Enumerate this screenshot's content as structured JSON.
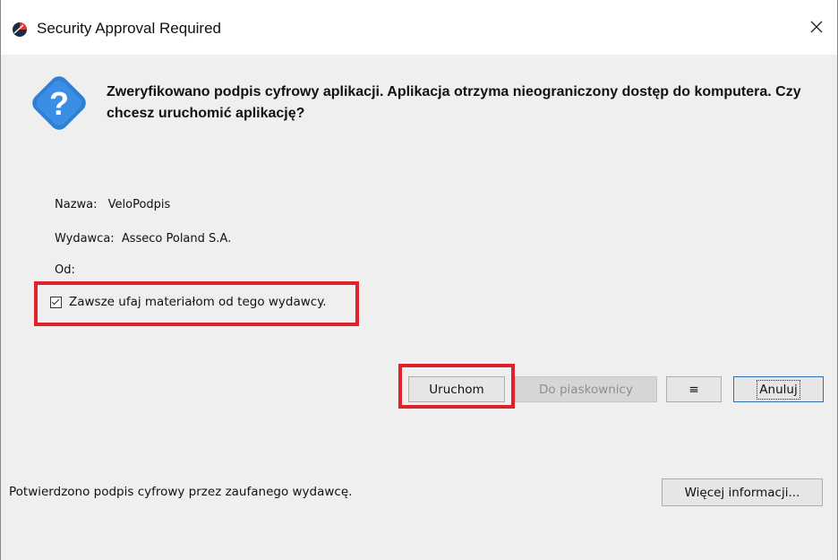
{
  "window": {
    "title": "Security Approval Required",
    "close_icon": "close-icon"
  },
  "message": {
    "heading": "Zweryfikowano podpis cyfrowy aplikacji. Aplikacja otrzyma nieograniczony dostęp do komputera. Czy chcesz uruchomić aplikację?",
    "icon": "question-icon"
  },
  "details": {
    "name_label": "Nazwa:",
    "name_value": "VeloPodpis",
    "publisher_label": "Wydawca:",
    "publisher_value": "Asseco Poland S.A.",
    "from_label": "Od:",
    "from_value": ""
  },
  "trust": {
    "label": "Zawsze ufaj materiałom od tego wydawcy.",
    "checked": true
  },
  "buttons": {
    "run": "Uruchom",
    "sandbox": "Do piaskownicy",
    "menu": "≡",
    "cancel": "Anuluj",
    "more_info": "Więcej informacji..."
  },
  "footer": {
    "status": "Potwierdzono podpis cyfrowy przez zaufanego wydawcę."
  },
  "colors": {
    "highlight": "#e0202a",
    "question_icon_fill": "#2f7fd6",
    "background": "#f0f0f0"
  }
}
